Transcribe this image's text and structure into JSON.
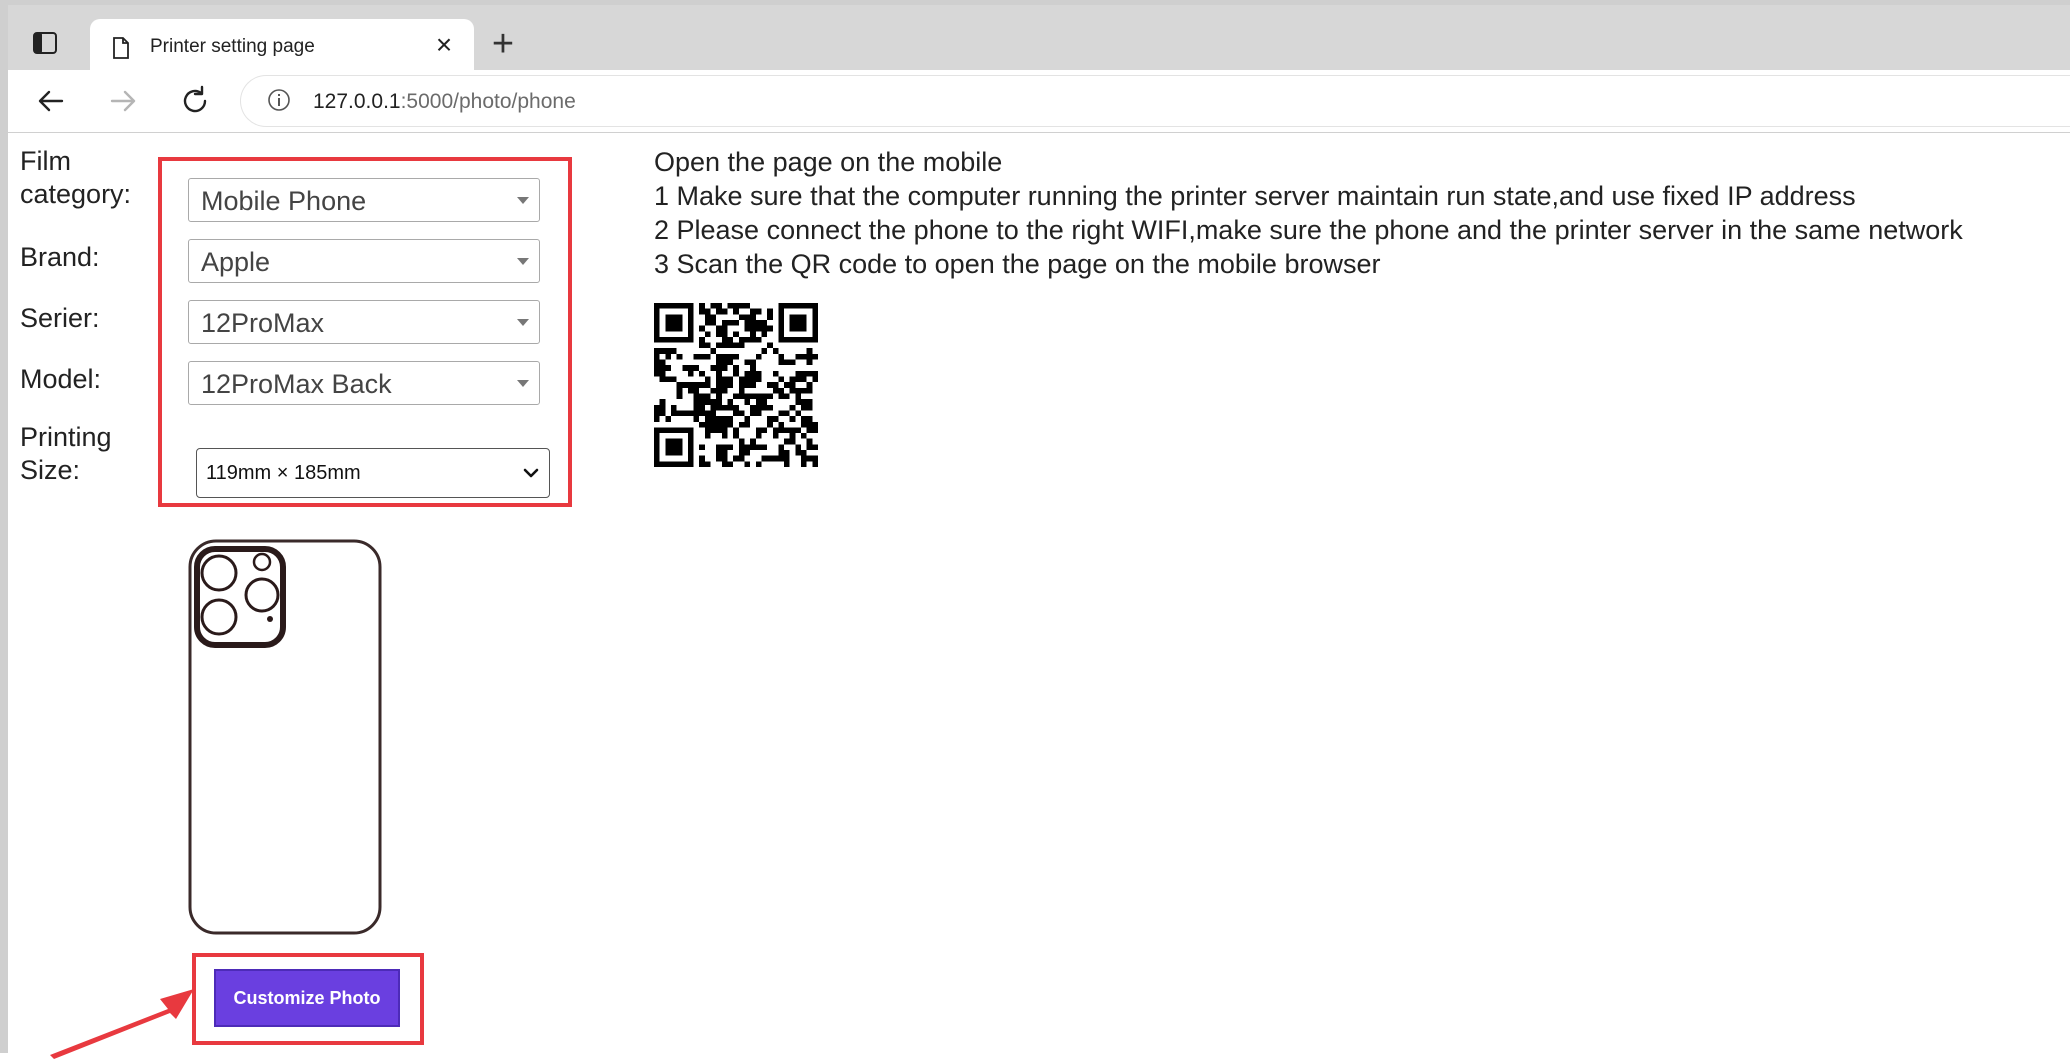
{
  "browser": {
    "tab_title": "Printer setting page",
    "tab_close_glyph": "×",
    "new_tab_glyph": "+",
    "url_host": "127.0.0.1",
    "url_path": ":5000/photo/phone"
  },
  "form": {
    "film_category_label_line1": "Film",
    "film_category_label_line2": "category:",
    "film_category_value": "Mobile Phone",
    "brand_label": "Brand:",
    "brand_value": "Apple",
    "serier_label": "Serier:",
    "serier_value": "12ProMax",
    "model_label": "Model:",
    "model_value": "12ProMax Back",
    "printing_size_label_line1": "Printing",
    "printing_size_label_line2": "Size:",
    "printing_size_value": "119mm × 185mm"
  },
  "actions": {
    "customize_label": "Customize Photo"
  },
  "instructions": {
    "heading": "Open the page on the mobile",
    "step1": "1 Make sure that the computer running the printer server maintain run state,and use fixed IP address",
    "step2": "2 Please connect the phone to the right WIFI,make sure the phone and the printer server in the same network",
    "step3": "3 Scan the QR code to open the page on the mobile browser"
  },
  "colors": {
    "highlight_red": "#e8393f",
    "button_purple": "#6a3fe0"
  },
  "icons": [
    "sidebar-toggle-icon",
    "page-icon",
    "close-icon",
    "plus-icon",
    "back-arrow-icon",
    "forward-arrow-icon",
    "reload-icon",
    "info-icon",
    "dropdown-arrow-icon",
    "chevron-down-icon",
    "qr-code",
    "phone-outline"
  ]
}
